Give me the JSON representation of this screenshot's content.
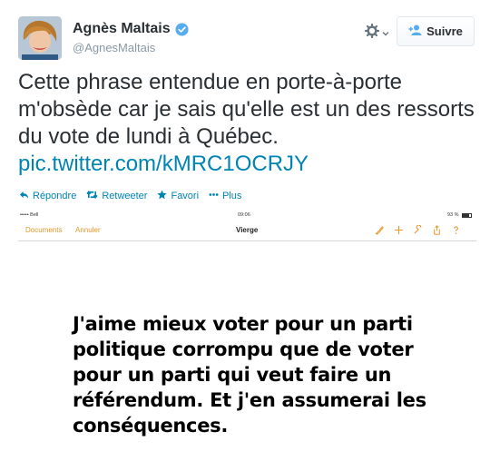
{
  "author": {
    "name": "Agnès Maltais",
    "handle": "@AgnesMaltais"
  },
  "follow_label": "Suivre",
  "tweet": {
    "text": "Cette phrase entendue en porte-à-porte m'obsède car je sais qu'elle est un des ressorts du vote de lundi à Québec.",
    "link": "pic.twitter.com/kMRC1OCRJY"
  },
  "actions": {
    "reply": "Répondre",
    "retweet": "Retweeter",
    "favorite": "Favori",
    "more": "Plus"
  },
  "embed": {
    "status": {
      "carrier": "••••• Bell",
      "time": "09:06",
      "battery": "93 %"
    },
    "nav": {
      "documents": "Documents",
      "cancel": "Annuler",
      "title": "Vierge"
    },
    "quote": "J'aime mieux voter pour un parti politique corrompu que de voter pour un parti qui veut faire un référendum. Et j'en assumerai les conséquences."
  },
  "colors": {
    "link": "#0084b4",
    "verified": "#55acee",
    "ios_accent": "#e8972b"
  },
  "icons": [
    "verified-badge-icon",
    "gear-icon",
    "chevron-down-icon",
    "follow-person-icon",
    "reply-icon",
    "retweet-icon",
    "star-icon",
    "more-dots-icon"
  ]
}
